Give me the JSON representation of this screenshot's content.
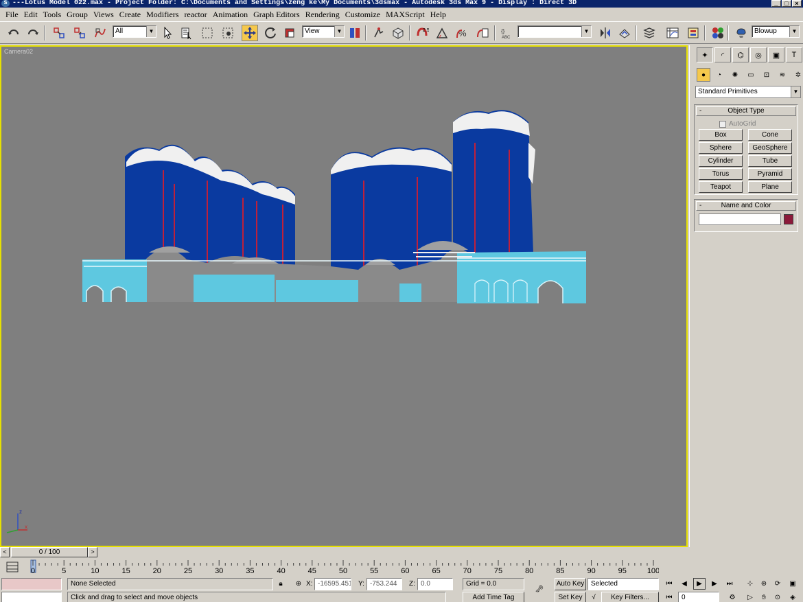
{
  "window": {
    "title": "---Lotus Model 022.max    - Project Folder: C:\\Documents and Settings\\zeng ke\\My Documents\\3dsmax    - Autodesk 3ds Max 9    - Display : Direct 3D",
    "buttons": [
      "_",
      "□",
      "×"
    ]
  },
  "menu": [
    "File",
    "Edit",
    "Tools",
    "Group",
    "Views",
    "Create",
    "Modifiers",
    "reactor",
    "Animation",
    "Graph Editors",
    "Rendering",
    "Customize",
    "MAXScript",
    "Help"
  ],
  "toolbar": {
    "selection_filter": "All",
    "reference_coord": "View",
    "snap_angle": "2.5",
    "named_selection": "",
    "render_type": "Blowup"
  },
  "viewport": {
    "label": "Camera02",
    "axis_z": "z",
    "axis_x": "x",
    "colors": {
      "background": "#7f7f7f",
      "border": "#e6e000",
      "tower": "#0a3aa0",
      "podium": "#5ec8e0",
      "roof": "#f0f0f0",
      "structure": "#8a8a8a",
      "accent": "#c0203a"
    }
  },
  "command_panel": {
    "category": "Standard Primitives",
    "object_type_title": "Object Type",
    "autogrid_label": "AutoGrid",
    "primitives": [
      "Box",
      "Cone",
      "Sphere",
      "GeoSphere",
      "Cylinder",
      "Tube",
      "Torus",
      "Pyramid",
      "Teapot",
      "Plane"
    ],
    "name_color_title": "Name and Color",
    "object_name": "",
    "object_color": "#8b1a3a"
  },
  "timeline": {
    "frame_display": "0 / 100",
    "ticks": [
      "0",
      "5",
      "10",
      "15",
      "20",
      "25",
      "30",
      "35",
      "40",
      "45",
      "50",
      "55",
      "60",
      "65",
      "70",
      "75",
      "80",
      "85",
      "90",
      "95",
      "100"
    ]
  },
  "status": {
    "selection": "None Selected",
    "prompt": "Click and drag to select and move objects",
    "x_label": "X:",
    "x_value": "-16595.451",
    "y_label": "Y:",
    "y_value": "-753.244",
    "z_label": "Z:",
    "z_value": "0.0",
    "grid": "Grid = 0.0",
    "add_time_tag": "Add Time Tag",
    "auto_key": "Auto Key",
    "set_key": "Set Key",
    "key_mode": "Selected",
    "key_filters": "Key Filters...",
    "current_frame": "0"
  }
}
